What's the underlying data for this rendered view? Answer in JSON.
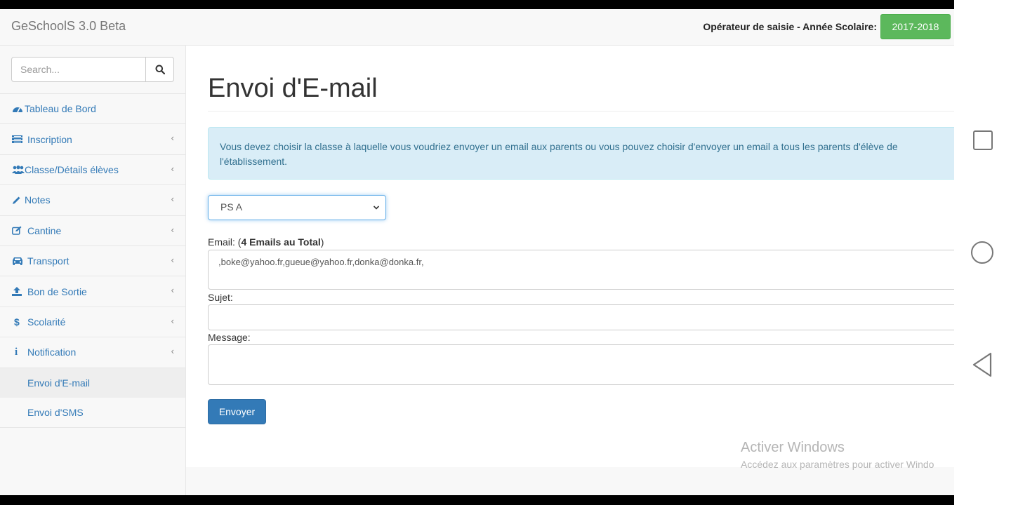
{
  "header": {
    "brand": "GeSchoolS 3.0 Beta",
    "operator_text": "Opérateur de saisie - Année Scolaire:",
    "school_year": "2017-2018"
  },
  "sidebar": {
    "search_placeholder": "Search...",
    "items": [
      {
        "label": "Tableau de Bord",
        "icon": "dashboard-icon",
        "has_chevron": false
      },
      {
        "label": "Inscription",
        "icon": "list-icon",
        "has_chevron": true
      },
      {
        "label": "Classe/Détails élèves",
        "icon": "users-icon",
        "has_chevron": true
      },
      {
        "label": "Notes",
        "icon": "pencil-icon",
        "has_chevron": true
      },
      {
        "label": "Cantine",
        "icon": "edit-icon",
        "has_chevron": true
      },
      {
        "label": "Transport",
        "icon": "car-icon",
        "has_chevron": true
      },
      {
        "label": "Bon de Sortie",
        "icon": "upload-icon",
        "has_chevron": true
      },
      {
        "label": "Scolarité",
        "icon": "dollar-icon",
        "has_chevron": true
      },
      {
        "label": "Notification",
        "icon": "info-icon",
        "has_chevron": true
      }
    ],
    "subitems": [
      {
        "label": "Envoi d'E-mail",
        "active": true
      },
      {
        "label": "Envoi d'SMS",
        "active": false
      }
    ]
  },
  "main": {
    "title": "Envoi d'E-mail",
    "alert": "Vous devez choisir la classe à laquelle vous voudriez envoyer un email aux parents ou vous pouvez choisir d'envoyer un email a tous les parents d'élève de l'établissement.",
    "class_select": "PS A",
    "email_label": "Email: (",
    "email_count_label": "4 Emails au Total",
    "email_label_end": ")",
    "email_value": ",boke@yahoo.fr,gueue@yahoo.fr,donka@donka.fr,",
    "subject_label": "Sujet:",
    "subject_value": "",
    "message_label": "Message:",
    "message_value": "",
    "send_button": "Envoyer"
  },
  "watermark": {
    "line1": "Activer Windows",
    "line2": "Accédez aux paramètres pour activer Windo"
  },
  "colors": {
    "accent": "#337ab7",
    "year_badge": "#5cb85c",
    "alert_bg": "#d9edf7",
    "alert_text": "#31708f"
  }
}
